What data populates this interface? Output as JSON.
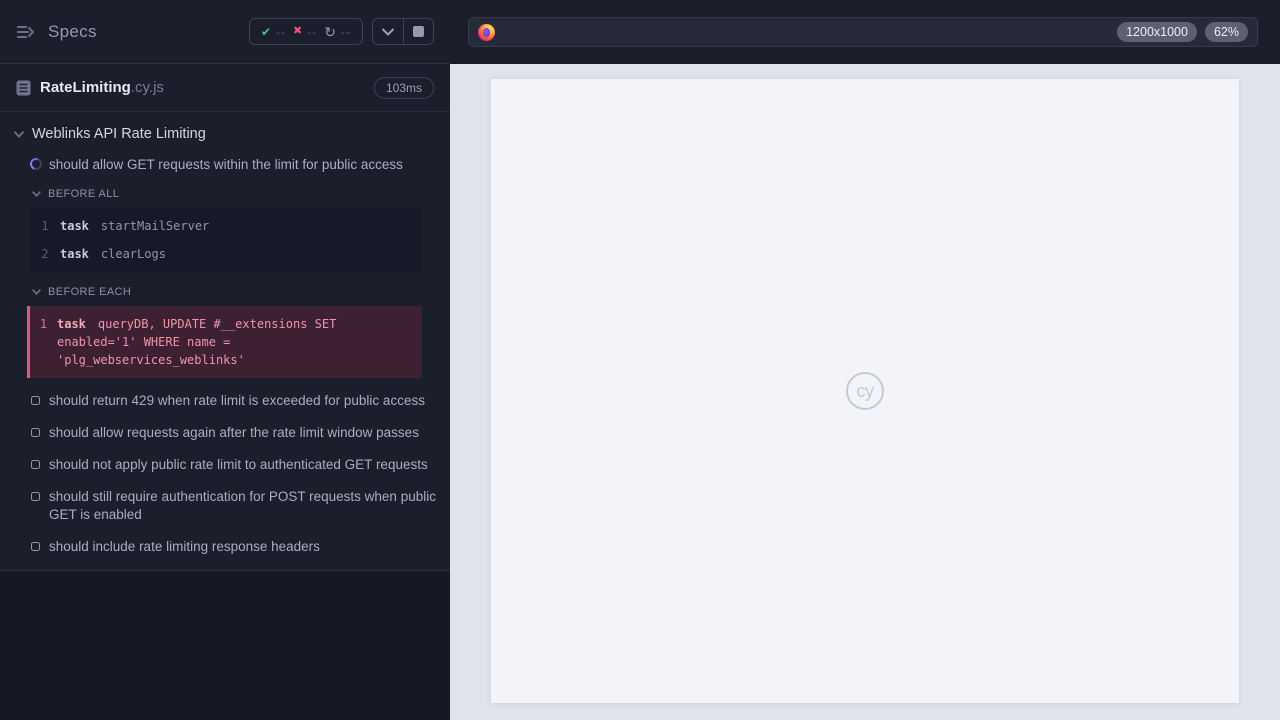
{
  "sidebar": {
    "title": "Specs",
    "stats": {
      "passed": "--",
      "failed": "--",
      "pending": "--"
    },
    "spec": {
      "name": "RateLimiting",
      "ext": ".cy.js",
      "duration": "103ms"
    },
    "suite": {
      "title": "Weblinks API Rate Limiting",
      "running_test": "should allow GET requests within the limit for public access",
      "before_all": {
        "label": "BEFORE ALL",
        "commands": [
          {
            "n": "1",
            "method": "task",
            "message": "startMailServer"
          },
          {
            "n": "2",
            "method": "task",
            "message": "clearLogs"
          }
        ]
      },
      "before_each": {
        "label": "BEFORE EACH",
        "commands": [
          {
            "n": "1",
            "method": "task",
            "message": "queryDB, UPDATE #__extensions SET enabled='1' WHERE name = 'plg_webservices_weblinks'"
          }
        ]
      },
      "pending_tests": [
        "should return 429 when rate limit is exceeded for public access",
        "should allow requests again after the rate limit window passes",
        "should not apply public rate limit to authenticated GET requests",
        "should still require authentication for POST requests when public GET is enabled",
        "should include rate limiting response headers"
      ]
    }
  },
  "browser": {
    "url_value": "",
    "viewport_size": "1200x1000",
    "zoom_level": "62%"
  },
  "stage": {
    "logo_text": "cy"
  },
  "colors": {
    "pass_green": "#3dc98d",
    "fail_red": "#e8546b",
    "highlight_pink": "#e2567c",
    "running_blue": "#6572ee",
    "sidebar_bg": "#1b1e2b",
    "stage_bg": "#e0e3ec",
    "viewport_bg": "#f3f4f8"
  }
}
